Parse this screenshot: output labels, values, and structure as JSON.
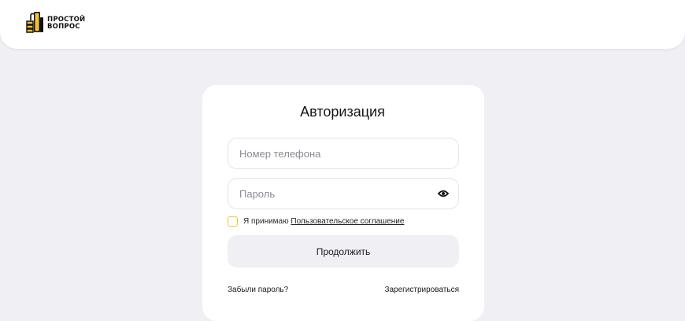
{
  "header": {
    "logo": {
      "line1": "ПРОСТОЙ",
      "line2": "ВОПРОС",
      "icon": "thumbs-up-logo-icon",
      "brand_color": "#f2c230"
    }
  },
  "auth": {
    "title": "Авторизация",
    "phone": {
      "placeholder": "Номер телефона",
      "value": ""
    },
    "password": {
      "placeholder": "Пароль",
      "value": "",
      "toggle_icon": "eye-icon"
    },
    "agreement": {
      "prefix": "Я принимаю ",
      "link": "Пользовательское соглашение",
      "checked": false
    },
    "submit_label": "Продолжить",
    "forgot_label": "Забыли пароль?",
    "register_label": "Зарегистрироваться"
  },
  "colors": {
    "background": "#efeff4",
    "card": "#ffffff",
    "accent": "#f2c230",
    "button_bg": "#efeff4"
  }
}
